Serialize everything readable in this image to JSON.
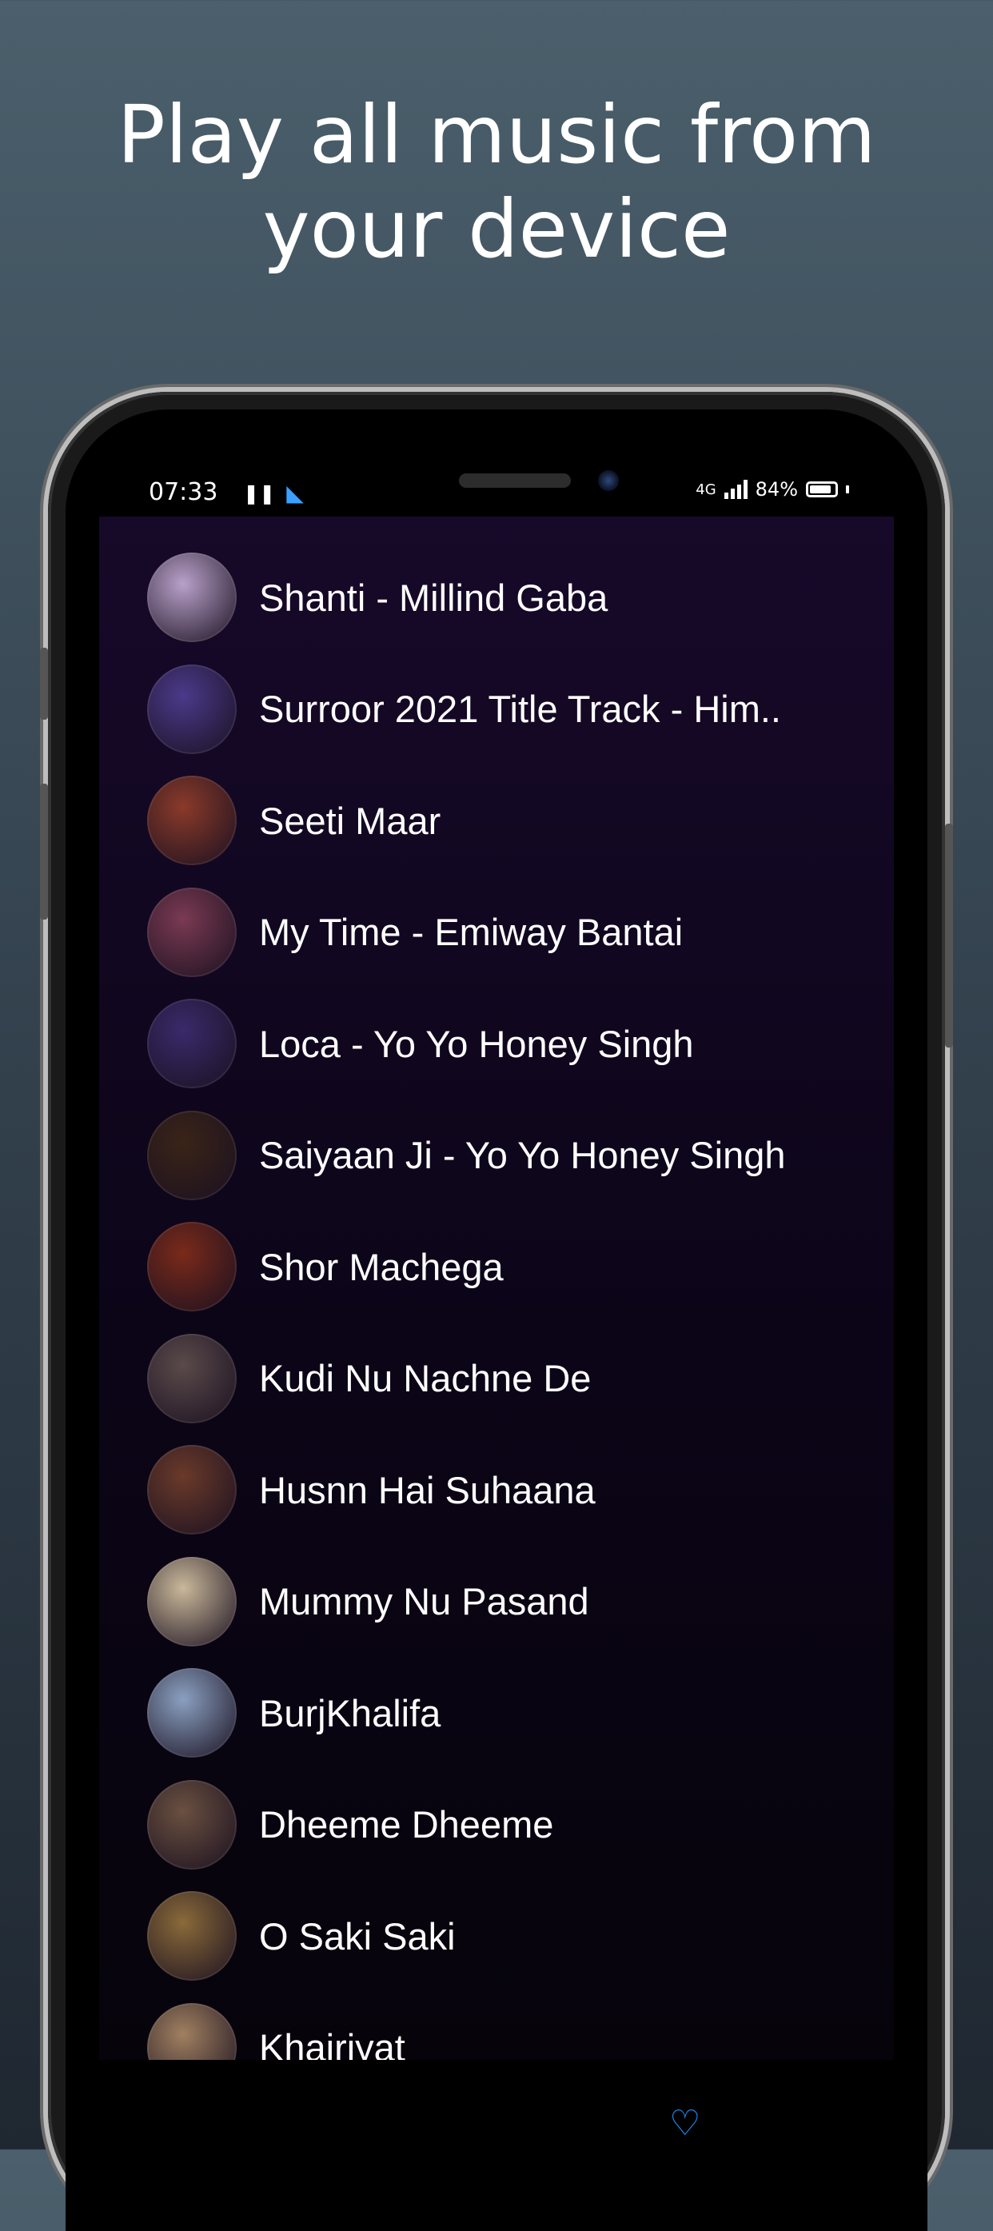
{
  "headline": "Play all music from your device",
  "status": {
    "time": "07:33",
    "network": "4G",
    "battery": "84%"
  },
  "songs": [
    {
      "title": "Shanti - Millind Gaba",
      "art": "#b8a1c9"
    },
    {
      "title": "Surroor 2021 Title Track - Him..",
      "art": "#4a3a8a"
    },
    {
      "title": "Seeti Maar",
      "art": "#8a3a2a"
    },
    {
      "title": "My Time - Emiway Bantai",
      "art": "#7a3a52"
    },
    {
      "title": "Loca - Yo Yo Honey Singh",
      "art": "#3a2a6a"
    },
    {
      "title": "Saiyaan Ji - Yo Yo Honey Singh",
      "art": "#3a2418"
    },
    {
      "title": "Shor Machega",
      "art": "#7a2a1a"
    },
    {
      "title": "Kudi Nu Nachne De",
      "art": "#5a4a4a"
    },
    {
      "title": "Husnn Hai Suhaana",
      "art": "#6a3a2a"
    },
    {
      "title": "Mummy Nu Pasand",
      "art": "#c9b89a"
    },
    {
      "title": "BurjKhalifa",
      "art": "#8aa0c0"
    },
    {
      "title": "Dheeme Dheeme",
      "art": "#6a5040"
    },
    {
      "title": "O Saki Saki",
      "art": "#8a6a3a"
    },
    {
      "title": "Khairiyat",
      "art": "#a08060"
    }
  ],
  "nav": {
    "icon": "heart-icon",
    "accent": "#1e90ff"
  }
}
